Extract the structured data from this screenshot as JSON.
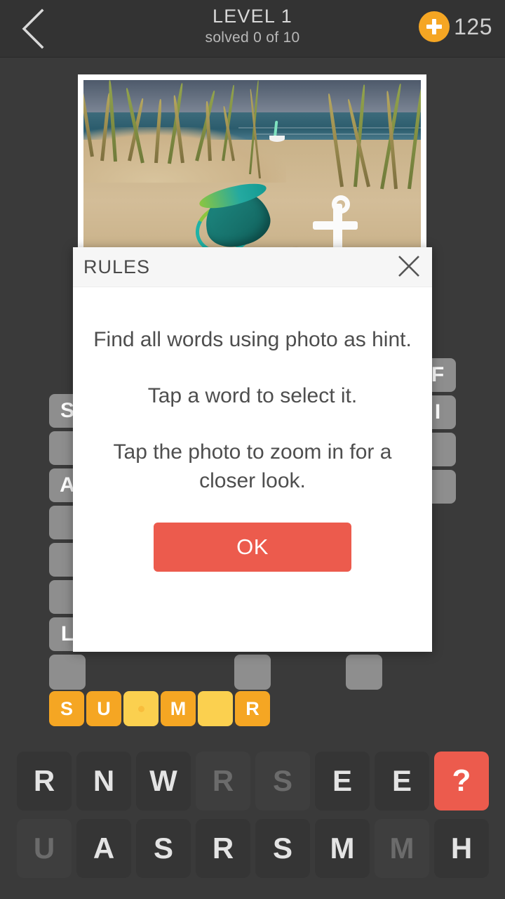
{
  "header": {
    "back_icon": "chevron-left-icon",
    "level_title": "LEVEL 1",
    "progress_text": "solved 0 of 10",
    "coin_icon": "plus-circle-icon",
    "coin_count": "125",
    "accent_orange": "#f5a623",
    "bar_color": "#333333"
  },
  "photo": {
    "alt": "beach-photo",
    "description": "Beach scene with sand, dune grass, teal toy bucket, striped toy fish, white anchor ornament, seashells and a sailboat on the sea"
  },
  "crossword": {
    "left_column": [
      {
        "letter": "S",
        "filled": true
      },
      {
        "letter": "",
        "filled": false
      },
      {
        "letter": "A",
        "filled": true
      },
      {
        "letter": "",
        "filled": false
      },
      {
        "letter": "",
        "filled": false
      },
      {
        "letter": "",
        "filled": false
      },
      {
        "letter": "L",
        "filled": true
      },
      {
        "letter": "",
        "filled": false
      }
    ],
    "right_column": [
      {
        "letter": "F",
        "filled": true
      },
      {
        "letter": "I",
        "filled": true
      },
      {
        "letter": "",
        "filled": false
      },
      {
        "letter": "",
        "filled": false
      }
    ],
    "bottom_row": [
      {
        "letter": "",
        "filled": false
      },
      {
        "letter": "",
        "filled": false
      }
    ],
    "tile_color": "#8e8e8e",
    "tile_text_color": "#ffffff"
  },
  "current_word": {
    "tiles": [
      {
        "letter": "S",
        "state": "filled"
      },
      {
        "letter": "U",
        "state": "filled"
      },
      {
        "letter": "",
        "state": "empty-active"
      },
      {
        "letter": "M",
        "state": "filled"
      },
      {
        "letter": "",
        "state": "empty"
      },
      {
        "letter": "R",
        "state": "filled"
      }
    ],
    "filled_color": "#f5a623",
    "empty_color": "#fbd04f"
  },
  "keyboard": {
    "row1": [
      {
        "label": "R",
        "used": false
      },
      {
        "label": "N",
        "used": false
      },
      {
        "label": "W",
        "used": false
      },
      {
        "label": "R",
        "used": true
      },
      {
        "label": "S",
        "used": true
      },
      {
        "label": "E",
        "used": false
      },
      {
        "label": "E",
        "used": false
      },
      {
        "label": "?",
        "used": false,
        "hint": true
      }
    ],
    "row2": [
      {
        "label": "U",
        "used": true
      },
      {
        "label": "A",
        "used": false
      },
      {
        "label": "S",
        "used": false
      },
      {
        "label": "R",
        "used": false
      },
      {
        "label": "S",
        "used": false
      },
      {
        "label": "M",
        "used": false
      },
      {
        "label": "M",
        "used": true
      },
      {
        "label": "H",
        "used": false
      }
    ],
    "hint_color": "#ec5b4d",
    "key_color": "#353535"
  },
  "modal": {
    "title": "RULES",
    "close_icon": "close-x-icon",
    "line1": "Find all words using photo as hint.",
    "line2": "Tap a word to select it.",
    "line3": "Tap the photo to zoom in for a closer look.",
    "ok_label": "OK",
    "ok_color": "#ec5b4d"
  }
}
